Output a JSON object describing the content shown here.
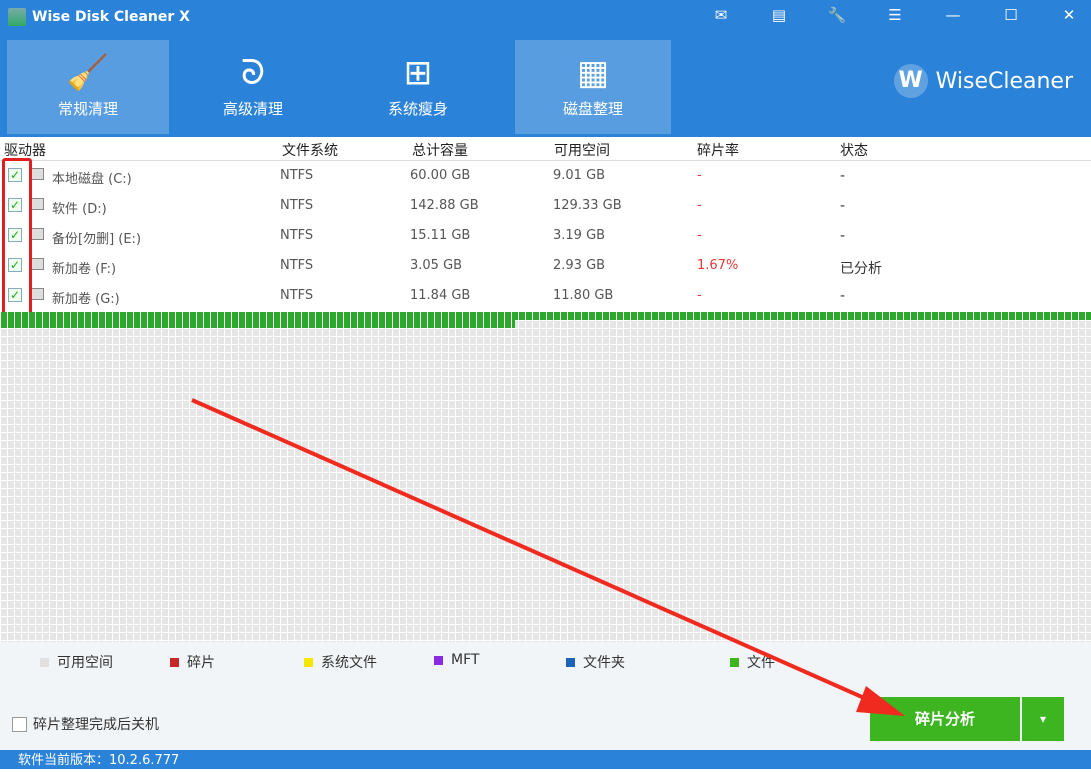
{
  "app": {
    "title": "Wise Disk Cleaner X",
    "brand": "WiseCleaner",
    "brand_letter": "W"
  },
  "window_controls": [
    "✉",
    "▤",
    "🔧",
    "☰",
    "—",
    "☐",
    "✕"
  ],
  "tabs": [
    {
      "label": "常规清理",
      "icon": "broom-icon"
    },
    {
      "label": "高级清理",
      "icon": "vacuum-icon"
    },
    {
      "label": "系统瘦身",
      "icon": "windows-icon"
    },
    {
      "label": "磁盘整理",
      "icon": "defrag-icon"
    }
  ],
  "table": {
    "headers": [
      "驱动器",
      "文件系统",
      "总计容量",
      "可用空间",
      "碎片率",
      "状态"
    ],
    "rows": [
      {
        "drive": "本地磁盘 (C:)",
        "fs": "NTFS",
        "total": "60.00 GB",
        "free": "9.01 GB",
        "frag": "-",
        "status": "-"
      },
      {
        "drive": "软件 (D:)",
        "fs": "NTFS",
        "total": "142.88 GB",
        "free": "129.33 GB",
        "frag": "-",
        "status": "-"
      },
      {
        "drive": "备份[勿删] (E:)",
        "fs": "NTFS",
        "total": "15.11 GB",
        "free": "3.19 GB",
        "frag": "-",
        "status": "-"
      },
      {
        "drive": "新加卷 (F:)",
        "fs": "NTFS",
        "total": "3.05 GB",
        "free": "2.93 GB",
        "frag": "1.67%",
        "status": "已分析"
      },
      {
        "drive": "新加卷 (G:)",
        "fs": "NTFS",
        "total": "11.84 GB",
        "free": "11.80 GB",
        "frag": "-",
        "status": "-"
      }
    ]
  },
  "legend": [
    {
      "label": "可用空间",
      "color": "#e0e0e0"
    },
    {
      "label": "碎片",
      "color": "#c62828"
    },
    {
      "label": "系统文件",
      "color": "#f5e600"
    },
    {
      "label": "MFT",
      "color": "#8a2be2"
    },
    {
      "label": "文件夹",
      "color": "#1e63b8"
    },
    {
      "label": "文件",
      "color": "#3cb521"
    }
  ],
  "shutdown_label": "碎片整理完成后关机",
  "analyze_button": "碎片分析",
  "dropdown": "▾",
  "version": "软件当前版本：10.2.6.777"
}
